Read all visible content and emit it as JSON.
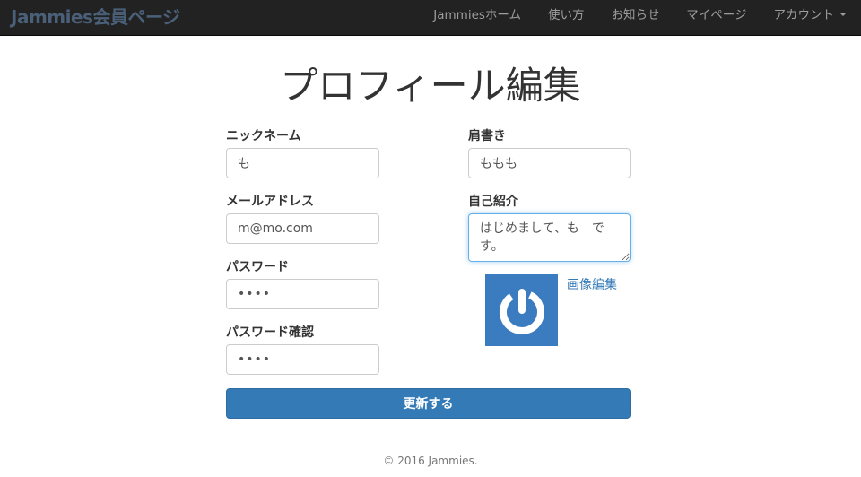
{
  "navbar": {
    "brand": "Jammies会員ページ",
    "items": [
      {
        "label": "Jammiesホーム"
      },
      {
        "label": "使い方"
      },
      {
        "label": "お知らせ"
      },
      {
        "label": "マイページ"
      },
      {
        "label": "アカウント"
      }
    ]
  },
  "page": {
    "title": "プロフィール編集"
  },
  "form": {
    "nickname": {
      "label": "ニックネーム",
      "value": "も"
    },
    "email": {
      "label": "メールアドレス",
      "value": "m@mo.com"
    },
    "password": {
      "label": "パスワード",
      "value": "••••"
    },
    "password_confirm": {
      "label": "パスワード確認",
      "value": "••••"
    },
    "title": {
      "label": "肩書き",
      "value": "ももも"
    },
    "bio": {
      "label": "自己紹介",
      "value": "はじめまして、も　です。"
    },
    "image_edit_label": "画像編集",
    "submit_label": "更新する"
  },
  "footer": {
    "copyright": "© 2016 Jammies."
  },
  "colors": {
    "navbar_bg": "#222222",
    "primary": "#337ab7",
    "avatar_bg": "#3b7bbf"
  }
}
